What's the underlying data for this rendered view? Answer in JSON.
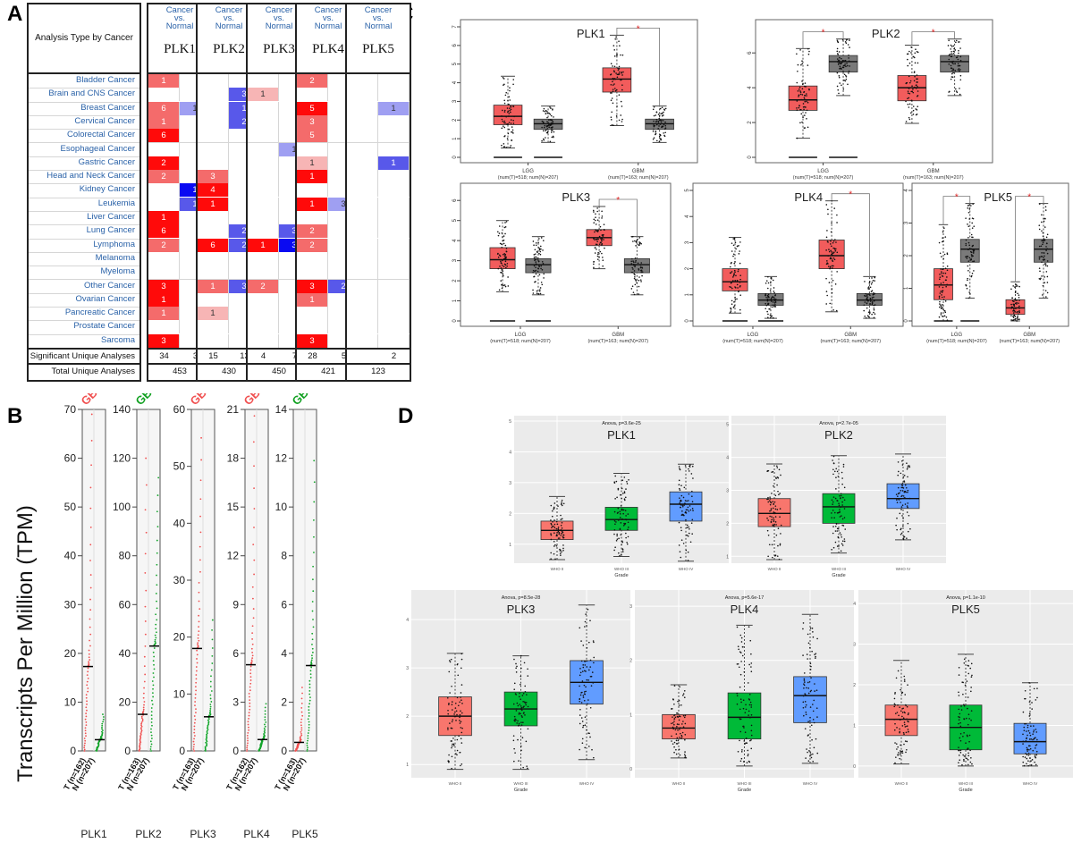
{
  "figure": {
    "panel_labels": [
      "A",
      "B",
      "C",
      "D"
    ]
  },
  "panel_a": {
    "header_title": "Analysis Type by Cancer",
    "column_header": "Cancer vs. Normal",
    "genes": [
      "PLK1",
      "PLK2",
      "PLK3",
      "PLK4",
      "PLK5"
    ],
    "cancers": [
      "Bladder Cancer",
      "Brain and CNS Cancer",
      "Breast Cancer",
      "Cervical Cancer",
      "Colorectal Cancer",
      "Esophageal Cancer",
      "Gastric Cancer",
      "Head and Neck Cancer",
      "Kidney Cancer",
      "Leukemia",
      "Liver Cancer",
      "Lung Cancer",
      "Lymphoma",
      "Melanoma",
      "Myeloma",
      "Other Cancer",
      "Ovarian Cancer",
      "Pancreatic Cancer",
      "Prostate Cancer",
      "Sarcoma"
    ],
    "cells": {
      "PLK1": {
        "up": [
          1,
          null,
          6,
          1,
          6,
          null,
          2,
          2,
          null,
          null,
          1,
          6,
          2,
          null,
          null,
          3,
          1,
          1,
          null,
          3
        ],
        "down": [
          null,
          null,
          1,
          null,
          null,
          null,
          null,
          null,
          1,
          1,
          null,
          null,
          null,
          null,
          null,
          null,
          null,
          null,
          null,
          null
        ]
      },
      "PLK2": {
        "up": [
          null,
          null,
          null,
          null,
          null,
          null,
          null,
          3,
          4,
          1,
          null,
          null,
          6,
          null,
          null,
          1,
          null,
          1,
          null,
          null
        ],
        "down": [
          null,
          3,
          1,
          2,
          null,
          null,
          null,
          null,
          null,
          null,
          null,
          2,
          2,
          null,
          null,
          3,
          null,
          null,
          null,
          null
        ]
      },
      "PLK3": {
        "up": [
          null,
          1,
          null,
          null,
          null,
          null,
          null,
          null,
          null,
          null,
          null,
          null,
          1,
          null,
          null,
          2,
          null,
          null,
          null,
          null
        ],
        "down": [
          null,
          null,
          null,
          null,
          null,
          1,
          null,
          null,
          null,
          null,
          null,
          3,
          3,
          null,
          null,
          null,
          null,
          null,
          null,
          null
        ]
      },
      "PLK4": {
        "up": [
          2,
          null,
          5,
          3,
          5,
          null,
          1,
          1,
          null,
          1,
          null,
          2,
          2,
          null,
          null,
          3,
          1,
          null,
          null,
          3
        ],
        "down": [
          null,
          null,
          null,
          null,
          null,
          null,
          null,
          null,
          null,
          3,
          null,
          null,
          null,
          null,
          null,
          2,
          null,
          null,
          null,
          null
        ]
      },
      "PLK5": {
        "up": [
          null,
          null,
          null,
          null,
          null,
          null,
          null,
          null,
          null,
          null,
          null,
          null,
          null,
          null,
          null,
          null,
          null,
          null,
          null,
          null
        ],
        "down": [
          null,
          null,
          1,
          null,
          null,
          null,
          1,
          null,
          null,
          null,
          null,
          null,
          null,
          null,
          null,
          null,
          null,
          null,
          null,
          null
        ]
      }
    },
    "intensity": {
      "PLK1": {
        "up": [
          2,
          0,
          2,
          2,
          3,
          0,
          3,
          2,
          0,
          0,
          3,
          3,
          2,
          0,
          0,
          3,
          3,
          2,
          0,
          3
        ],
        "down": [
          0,
          0,
          1,
          0,
          0,
          0,
          0,
          0,
          3,
          2,
          0,
          0,
          0,
          0,
          0,
          0,
          0,
          0,
          0,
          0
        ]
      },
      "PLK2": {
        "up": [
          0,
          0,
          0,
          0,
          0,
          0,
          0,
          2,
          3,
          3,
          0,
          0,
          3,
          0,
          0,
          2,
          0,
          1,
          0,
          0
        ],
        "down": [
          0,
          2,
          2,
          2,
          0,
          0,
          0,
          0,
          0,
          0,
          0,
          2,
          2,
          0,
          0,
          2,
          0,
          0,
          0,
          0
        ]
      },
      "PLK3": {
        "up": [
          0,
          1,
          0,
          0,
          0,
          0,
          0,
          0,
          0,
          0,
          0,
          0,
          3,
          0,
          0,
          2,
          0,
          0,
          0,
          0
        ],
        "down": [
          0,
          0,
          0,
          0,
          0,
          1,
          0,
          0,
          0,
          0,
          0,
          2,
          3,
          0,
          0,
          0,
          0,
          0,
          0,
          0
        ]
      },
      "PLK4": {
        "up": [
          2,
          0,
          3,
          2,
          2,
          0,
          1,
          3,
          0,
          3,
          0,
          2,
          2,
          0,
          0,
          3,
          2,
          0,
          0,
          3
        ],
        "down": [
          0,
          0,
          0,
          0,
          0,
          0,
          0,
          0,
          0,
          1,
          0,
          0,
          0,
          0,
          0,
          2,
          0,
          0,
          0,
          0
        ]
      },
      "PLK5": {
        "up": [
          0,
          0,
          0,
          0,
          0,
          0,
          0,
          0,
          0,
          0,
          0,
          0,
          0,
          0,
          0,
          0,
          0,
          0,
          0,
          0
        ],
        "down": [
          0,
          0,
          1,
          0,
          0,
          0,
          2,
          0,
          0,
          0,
          0,
          0,
          0,
          0,
          0,
          0,
          0,
          0,
          0,
          0
        ]
      }
    },
    "significant_label": "Significant Unique Analyses",
    "total_label": "Total Unique Analyses",
    "significant": {
      "PLK1": [
        "34",
        "3"
      ],
      "PLK2": [
        "15",
        "13"
      ],
      "PLK3": [
        "4",
        "7"
      ],
      "PLK4": [
        "28",
        "5"
      ],
      "PLK5": [
        "",
        "2"
      ]
    },
    "total": {
      "PLK1": "453",
      "PLK2": "430",
      "PLK3": "450",
      "PLK4": "421",
      "PLK5": "123"
    },
    "colors": {
      "up": [
        "#ffffff",
        "#f7b5b5",
        "#f46b6b",
        "#ff0a0a"
      ],
      "down": [
        "#ffffff",
        "#9f9ff2",
        "#5858ea",
        "#0a0af2"
      ]
    }
  },
  "chart_data": [
    {
      "id": "B",
      "type": "scatter",
      "title": "",
      "ylabel": "Transcripts Per Million (TPM)",
      "group_label": "GBM",
      "tick_labels": [
        "T (n=162)",
        "N (n=207)"
      ],
      "panels": [
        {
          "gene": "PLK1",
          "ylim": [
            0,
            70
          ],
          "yticks": [
            0,
            10,
            20,
            30,
            40,
            50,
            60,
            70
          ],
          "label_color": "#f05050",
          "tumor_median": 17.3,
          "normal_median": 2.3,
          "tumor_max": 69,
          "normal_max": 7.5,
          "tick_labels": [
            "T (n=162)",
            "N (n=207)"
          ]
        },
        {
          "gene": "PLK2",
          "ylim": [
            0,
            140
          ],
          "yticks": [
            0,
            20,
            40,
            60,
            80,
            100,
            120,
            140
          ],
          "label_color": "#10a020",
          "tumor_median": 15,
          "normal_median": 43,
          "tumor_max": 120,
          "normal_max": 112,
          "tick_labels": [
            "T (n=163)",
            "N (n=207)"
          ]
        },
        {
          "gene": "PLK3",
          "ylim": [
            0,
            60
          ],
          "yticks": [
            0,
            10,
            20,
            30,
            40,
            50,
            60
          ],
          "label_color": "#f05050",
          "tumor_median": 18,
          "normal_median": 6,
          "tumor_max": 55,
          "normal_max": 23,
          "tick_labels": [
            "T (n=163)",
            "N (n=207)"
          ]
        },
        {
          "gene": "PLK4",
          "ylim": [
            0,
            21
          ],
          "yticks": [
            0,
            3,
            6,
            9,
            12,
            15,
            18,
            21
          ],
          "label_color": "#f05050",
          "tumor_median": 5.3,
          "normal_median": 0.7,
          "tumor_max": 20.6,
          "normal_max": 2.9,
          "tick_labels": [
            "T (n=162)",
            "N (n=207)"
          ]
        },
        {
          "gene": "PLK5",
          "ylim": [
            0,
            14
          ],
          "yticks": [
            0,
            2,
            4,
            6,
            8,
            10,
            12,
            14
          ],
          "label_color": "#10a020",
          "tumor_median": 0.35,
          "normal_median": 3.5,
          "tumor_max": 2.6,
          "normal_max": 11.9,
          "tick_labels": [
            "T (n=163)",
            "N (n=207)"
          ]
        }
      ]
    },
    {
      "id": "C",
      "type": "box",
      "groups": [
        "LGG",
        "GBM"
      ],
      "group_sublabels": [
        "(num(T)=518; num(N)=207)",
        "(num(T)=163; num(N)=207)"
      ],
      "series_colors": {
        "tumor": "#f25c5c",
        "normal": "#7a7a7a"
      },
      "significance_marker": "*",
      "panels": [
        {
          "gene": "PLK1",
          "ylim": [
            0,
            7
          ],
          "yticks": [
            0,
            1,
            2,
            3,
            4,
            5,
            6,
            7
          ],
          "boxes": [
            {
              "q1": 1.75,
              "med": 2.2,
              "q3": 2.8,
              "lo": 0.5,
              "hi": 4.35
            },
            {
              "q1": 1.5,
              "med": 1.8,
              "q3": 2.05,
              "lo": 0.8,
              "hi": 2.75
            },
            {
              "q1": 3.5,
              "med": 4.2,
              "q3": 4.8,
              "lo": 1.7,
              "hi": 6.55
            },
            {
              "q1": 1.5,
              "med": 1.8,
              "q3": 2.05,
              "lo": 0.8,
              "hi": 2.75
            }
          ],
          "sig": [
            false,
            true
          ]
        },
        {
          "gene": "PLK2",
          "ylim": [
            0,
            7.5
          ],
          "yticks": [
            0,
            2,
            4,
            6
          ],
          "boxes": [
            {
              "q1": 2.7,
              "med": 3.3,
              "q3": 4.1,
              "lo": 1.1,
              "hi": 6.25
            },
            {
              "q1": 4.9,
              "med": 5.5,
              "q3": 5.85,
              "lo": 3.55,
              "hi": 6.8
            },
            {
              "q1": 3.25,
              "med": 4.0,
              "q3": 4.7,
              "lo": 1.95,
              "hi": 6.45
            },
            {
              "q1": 4.9,
              "med": 5.5,
              "q3": 5.85,
              "lo": 3.55,
              "hi": 6.8
            }
          ],
          "sig": [
            true,
            true
          ]
        },
        {
          "gene": "PLK3",
          "ylim": [
            0,
            6.5
          ],
          "yticks": [
            0,
            1,
            2,
            3,
            4,
            5,
            6
          ],
          "boxes": [
            {
              "q1": 2.6,
              "med": 3.05,
              "q3": 3.65,
              "lo": 1.45,
              "hi": 5.0
            },
            {
              "q1": 2.4,
              "med": 2.8,
              "q3": 3.1,
              "lo": 1.3,
              "hi": 4.2
            },
            {
              "q1": 3.75,
              "med": 4.15,
              "q3": 4.55,
              "lo": 2.6,
              "hi": 5.7
            },
            {
              "q1": 2.4,
              "med": 2.8,
              "q3": 3.1,
              "lo": 1.3,
              "hi": 4.2
            }
          ],
          "sig": [
            false,
            true
          ]
        },
        {
          "gene": "PLK4",
          "ylim": [
            0,
            5
          ],
          "yticks": [
            0,
            1,
            2,
            3,
            4,
            5
          ],
          "boxes": [
            {
              "q1": 1.15,
              "med": 1.5,
              "q3": 2.0,
              "lo": 0.3,
              "hi": 3.2
            },
            {
              "q1": 0.6,
              "med": 0.8,
              "q3": 1.05,
              "lo": 0.1,
              "hi": 1.7
            },
            {
              "q1": 2.0,
              "med": 2.5,
              "q3": 3.1,
              "lo": 0.35,
              "hi": 4.6
            },
            {
              "q1": 0.6,
              "med": 0.8,
              "q3": 1.05,
              "lo": 0.1,
              "hi": 1.7
            }
          ],
          "sig": [
            false,
            true
          ]
        },
        {
          "gene": "PLK5",
          "ylim": [
            0,
            4
          ],
          "yticks": [
            0,
            1,
            2,
            3,
            4
          ],
          "boxes": [
            {
              "q1": 0.65,
              "med": 1.1,
              "q3": 1.6,
              "lo": 0,
              "hi": 2.95
            },
            {
              "q1": 1.8,
              "med": 2.2,
              "q3": 2.5,
              "lo": 0.7,
              "hi": 3.6
            },
            {
              "q1": 0.2,
              "med": 0.4,
              "q3": 0.65,
              "lo": 0,
              "hi": 1.2
            },
            {
              "q1": 1.8,
              "med": 2.2,
              "q3": 2.5,
              "lo": 0.7,
              "hi": 3.6
            }
          ],
          "sig": [
            true,
            true
          ]
        }
      ]
    },
    {
      "id": "D",
      "type": "box",
      "xlabel": "Grade",
      "categories": [
        "WHO II",
        "WHO III",
        "WHO IV"
      ],
      "series_colors": [
        "#f8766d",
        "#00ba38",
        "#619cff"
      ],
      "panels": [
        {
          "gene": "PLK1",
          "anova": "Anova, p=3.6e-25",
          "ylim": [
            0.5,
            5
          ],
          "yticks": [
            1,
            2,
            3,
            4,
            5
          ],
          "boxes": [
            {
              "q1": 1.15,
              "med": 1.45,
              "q3": 1.75,
              "lo": 0.5,
              "hi": 2.55
            },
            {
              "q1": 1.45,
              "med": 1.8,
              "q3": 2.2,
              "lo": 0.6,
              "hi": 3.3
            },
            {
              "q1": 1.75,
              "med": 2.3,
              "q3": 2.7,
              "lo": 0.45,
              "hi": 3.6
            }
          ]
        },
        {
          "gene": "PLK2",
          "anova": "Anova, p=2.7e-05",
          "ylim": [
            0.9,
            5.1
          ],
          "yticks": [
            1,
            2,
            3,
            4,
            5
          ],
          "boxes": [
            {
              "q1": 1.9,
              "med": 2.3,
              "q3": 2.75,
              "lo": 0.9,
              "hi": 3.8
            },
            {
              "q1": 2.0,
              "med": 2.5,
              "q3": 2.9,
              "lo": 1.1,
              "hi": 4.05
            },
            {
              "q1": 2.45,
              "med": 2.75,
              "q3": 3.2,
              "lo": 1.5,
              "hi": 4.1
            }
          ]
        },
        {
          "gene": "PLK3",
          "anova": "Anova, p=8.5e-28",
          "ylim": [
            0.8,
            4.5
          ],
          "yticks": [
            1,
            2,
            3,
            4
          ],
          "boxes": [
            {
              "q1": 1.6,
              "med": 2.0,
              "q3": 2.4,
              "lo": 0.9,
              "hi": 3.3
            },
            {
              "q1": 1.8,
              "med": 2.15,
              "q3": 2.5,
              "lo": 0.9,
              "hi": 3.25
            },
            {
              "q1": 2.25,
              "med": 2.7,
              "q3": 3.15,
              "lo": 1.1,
              "hi": 4.3
            }
          ]
        },
        {
          "gene": "PLK4",
          "anova": "Anova, p=5.6e-17",
          "ylim": [
            -0.1,
            3.2
          ],
          "yticks": [
            0,
            1,
            2,
            3
          ],
          "boxes": [
            {
              "q1": 0.55,
              "med": 0.75,
              "q3": 1.0,
              "lo": 0.2,
              "hi": 1.55
            },
            {
              "q1": 0.55,
              "med": 0.95,
              "q3": 1.4,
              "lo": 0.05,
              "hi": 2.65
            },
            {
              "q1": 0.85,
              "med": 1.35,
              "q3": 1.7,
              "lo": 0.1,
              "hi": 2.85
            }
          ]
        },
        {
          "gene": "PLK5",
          "anova": "Anova, p=1.1e-10",
          "ylim": [
            -0.2,
            4.2
          ],
          "yticks": [
            0,
            1,
            2,
            3,
            4
          ],
          "boxes": [
            {
              "q1": 0.75,
              "med": 1.15,
              "q3": 1.5,
              "lo": 0.05,
              "hi": 2.6
            },
            {
              "q1": 0.4,
              "med": 0.95,
              "q3": 1.5,
              "lo": 0,
              "hi": 2.75
            },
            {
              "q1": 0.3,
              "med": 0.6,
              "q3": 1.05,
              "lo": 0,
              "hi": 2.05
            }
          ]
        }
      ]
    }
  ]
}
